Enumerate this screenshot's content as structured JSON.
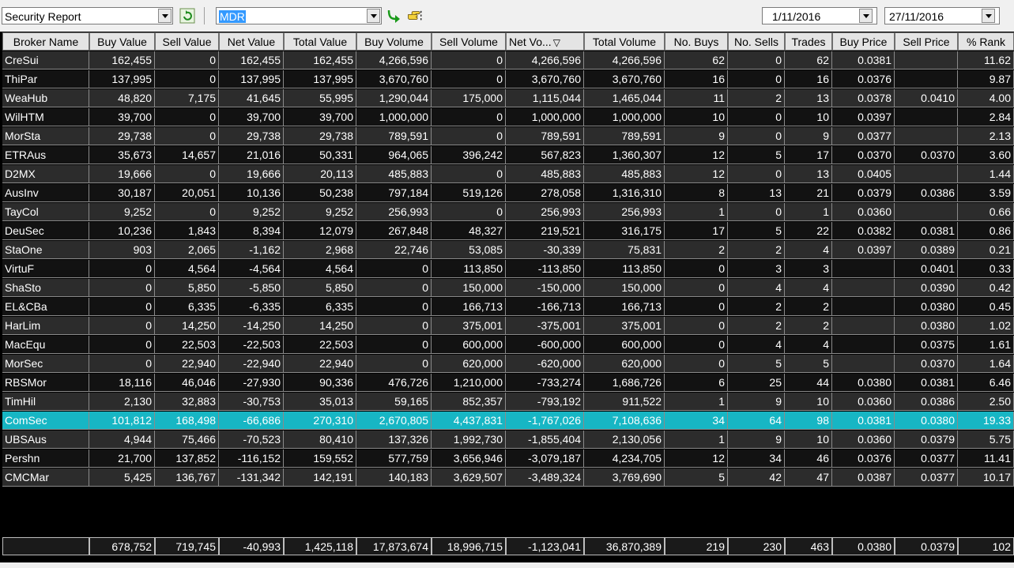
{
  "toolbar": {
    "report_select": "Security Report",
    "security_code": "MDR",
    "date_from": "1/11/2016",
    "date_to": "27/11/2016",
    "icons": [
      "refresh-icon",
      "go-arrow-icon",
      "pointing-hand-icon"
    ]
  },
  "columns": [
    "Broker Name",
    "Buy Value",
    "Sell Value",
    "Net Value",
    "Total Value",
    "Buy Volume",
    "Sell Volume",
    "Net Vo...",
    "Total Volume",
    "No. Buys",
    "No. Sells",
    "Trades",
    "Buy Price",
    "Sell Price",
    "% Rank"
  ],
  "sort_indicator": "▽",
  "rows": [
    [
      "CreSui",
      "162,455",
      "0",
      "162,455",
      "162,455",
      "4,266,596",
      "0",
      "4,266,596",
      "4,266,596",
      "62",
      "0",
      "62",
      "0.0381",
      "",
      "11.62"
    ],
    [
      "ThiPar",
      "137,995",
      "0",
      "137,995",
      "137,995",
      "3,670,760",
      "0",
      "3,670,760",
      "3,670,760",
      "16",
      "0",
      "16",
      "0.0376",
      "",
      "9.87"
    ],
    [
      "WeaHub",
      "48,820",
      "7,175",
      "41,645",
      "55,995",
      "1,290,044",
      "175,000",
      "1,115,044",
      "1,465,044",
      "11",
      "2",
      "13",
      "0.0378",
      "0.0410",
      "4.00"
    ],
    [
      "WilHTM",
      "39,700",
      "0",
      "39,700",
      "39,700",
      "1,000,000",
      "0",
      "1,000,000",
      "1,000,000",
      "10",
      "0",
      "10",
      "0.0397",
      "",
      "2.84"
    ],
    [
      "MorSta",
      "29,738",
      "0",
      "29,738",
      "29,738",
      "789,591",
      "0",
      "789,591",
      "789,591",
      "9",
      "0",
      "9",
      "0.0377",
      "",
      "2.13"
    ],
    [
      "ETRAus",
      "35,673",
      "14,657",
      "21,016",
      "50,331",
      "964,065",
      "396,242",
      "567,823",
      "1,360,307",
      "12",
      "5",
      "17",
      "0.0370",
      "0.0370",
      "3.60"
    ],
    [
      "D2MX",
      "19,666",
      "0",
      "19,666",
      "20,113",
      "485,883",
      "0",
      "485,883",
      "485,883",
      "12",
      "0",
      "13",
      "0.0405",
      "",
      "1.44"
    ],
    [
      "AusInv",
      "30,187",
      "20,051",
      "10,136",
      "50,238",
      "797,184",
      "519,126",
      "278,058",
      "1,316,310",
      "8",
      "13",
      "21",
      "0.0379",
      "0.0386",
      "3.59"
    ],
    [
      "TayCol",
      "9,252",
      "0",
      "9,252",
      "9,252",
      "256,993",
      "0",
      "256,993",
      "256,993",
      "1",
      "0",
      "1",
      "0.0360",
      "",
      "0.66"
    ],
    [
      "DeuSec",
      "10,236",
      "1,843",
      "8,394",
      "12,079",
      "267,848",
      "48,327",
      "219,521",
      "316,175",
      "17",
      "5",
      "22",
      "0.0382",
      "0.0381",
      "0.86"
    ],
    [
      "StaOne",
      "903",
      "2,065",
      "-1,162",
      "2,968",
      "22,746",
      "53,085",
      "-30,339",
      "75,831",
      "2",
      "2",
      "4",
      "0.0397",
      "0.0389",
      "0.21"
    ],
    [
      "VirtuF",
      "0",
      "4,564",
      "-4,564",
      "4,564",
      "0",
      "113,850",
      "-113,850",
      "113,850",
      "0",
      "3",
      "3",
      "",
      "0.0401",
      "0.33"
    ],
    [
      "ShaSto",
      "0",
      "5,850",
      "-5,850",
      "5,850",
      "0",
      "150,000",
      "-150,000",
      "150,000",
      "0",
      "4",
      "4",
      "",
      "0.0390",
      "0.42"
    ],
    [
      "EL&CBa",
      "0",
      "6,335",
      "-6,335",
      "6,335",
      "0",
      "166,713",
      "-166,713",
      "166,713",
      "0",
      "2",
      "2",
      "",
      "0.0380",
      "0.45"
    ],
    [
      "HarLim",
      "0",
      "14,250",
      "-14,250",
      "14,250",
      "0",
      "375,001",
      "-375,001",
      "375,001",
      "0",
      "2",
      "2",
      "",
      "0.0380",
      "1.02"
    ],
    [
      "MacEqu",
      "0",
      "22,503",
      "-22,503",
      "22,503",
      "0",
      "600,000",
      "-600,000",
      "600,000",
      "0",
      "4",
      "4",
      "",
      "0.0375",
      "1.61"
    ],
    [
      "MorSec",
      "0",
      "22,940",
      "-22,940",
      "22,940",
      "0",
      "620,000",
      "-620,000",
      "620,000",
      "0",
      "5",
      "5",
      "",
      "0.0370",
      "1.64"
    ],
    [
      "RBSMor",
      "18,116",
      "46,046",
      "-27,930",
      "90,336",
      "476,726",
      "1,210,000",
      "-733,274",
      "1,686,726",
      "6",
      "25",
      "44",
      "0.0380",
      "0.0381",
      "6.46"
    ],
    [
      "TimHil",
      "2,130",
      "32,883",
      "-30,753",
      "35,013",
      "59,165",
      "852,357",
      "-793,192",
      "911,522",
      "1",
      "9",
      "10",
      "0.0360",
      "0.0386",
      "2.50"
    ],
    [
      "ComSec",
      "101,812",
      "168,498",
      "-66,686",
      "270,310",
      "2,670,805",
      "4,437,831",
      "-1,767,026",
      "7,108,636",
      "34",
      "64",
      "98",
      "0.0381",
      "0.0380",
      "19.33"
    ],
    [
      "UBSAus",
      "4,944",
      "75,466",
      "-70,523",
      "80,410",
      "137,326",
      "1,992,730",
      "-1,855,404",
      "2,130,056",
      "1",
      "9",
      "10",
      "0.0360",
      "0.0379",
      "5.75"
    ],
    [
      "Pershn",
      "21,700",
      "137,852",
      "-116,152",
      "159,552",
      "577,759",
      "3,656,946",
      "-3,079,187",
      "4,234,705",
      "12",
      "34",
      "46",
      "0.0376",
      "0.0377",
      "11.41"
    ],
    [
      "CMCMar",
      "5,425",
      "136,767",
      "-131,342",
      "142,191",
      "140,183",
      "3,629,507",
      "-3,489,324",
      "3,769,690",
      "5",
      "42",
      "47",
      "0.0387",
      "0.0377",
      "10.17"
    ]
  ],
  "highlighted_broker": "ComSec",
  "highlight_color": "#17b6c4",
  "totals": [
    "",
    "678,752",
    "719,745",
    "-40,993",
    "1,425,118",
    "17,873,674",
    "18,996,715",
    "-1,123,041",
    "36,870,389",
    "219",
    "230",
    "463",
    "0.0380",
    "0.0379",
    "102"
  ]
}
